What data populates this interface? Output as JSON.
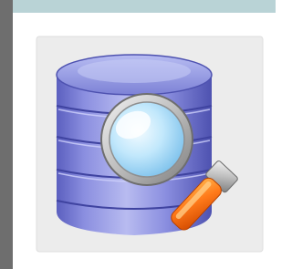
{
  "frame": {
    "top_bar_color": "#b9d3d6",
    "left_bar_color": "#6e6e6e",
    "tile_color": "#ececec",
    "background_color": "#ffffff"
  },
  "icon": {
    "name": "database-search-icon",
    "database_color": "#8c8ee0",
    "lens_color": "#bfe6fb",
    "handle_color": "#ff7a1a",
    "frame_color": "#c9c9c9"
  }
}
